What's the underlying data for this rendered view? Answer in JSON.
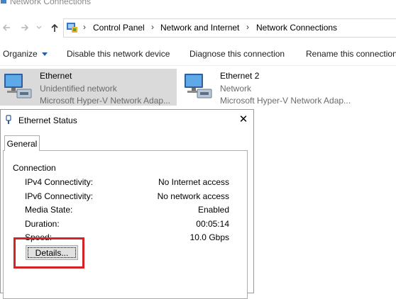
{
  "window": {
    "title": "Network Connections",
    "icon": "network-connections-icon"
  },
  "address_bar": {
    "back_icon": "back-arrow-icon",
    "forward_icon": "forward-arrow-icon",
    "up_icon": "up-arrow-icon",
    "location_icon": "control-panel-icon",
    "breadcrumbs": [
      "Control Panel",
      "Network and Internet",
      "Network Connections"
    ],
    "separator": "›"
  },
  "command_bar": {
    "organize": "Organize",
    "disable": "Disable this network device",
    "diagnose": "Diagnose this connection",
    "rename": "Rename this connection"
  },
  "adapters": [
    {
      "name": "Ethernet",
      "status": "Unidentified network",
      "device": "Microsoft Hyper-V Network Adap...",
      "selected": true
    },
    {
      "name": "Ethernet 2",
      "status": "Network",
      "device": "Microsoft Hyper-V Network Adap...",
      "selected": false
    }
  ],
  "dialog": {
    "title": "Ethernet Status",
    "close_glyph": "✕",
    "tabs": [
      "General"
    ],
    "group_label": "Connection",
    "properties": [
      {
        "label": "IPv4 Connectivity:",
        "value": "No Internet access"
      },
      {
        "label": "IPv6 Connectivity:",
        "value": "No network access"
      },
      {
        "label": "Media State:",
        "value": "Enabled"
      },
      {
        "label": "Duration:",
        "value": "00:05:14"
      },
      {
        "label": "Speed:",
        "value": "10.0 Gbps"
      }
    ],
    "details_button": "Details..."
  },
  "colors": {
    "highlight": "#d42327",
    "selected_tile": "#dadada",
    "accent": "#1e5fa6"
  }
}
